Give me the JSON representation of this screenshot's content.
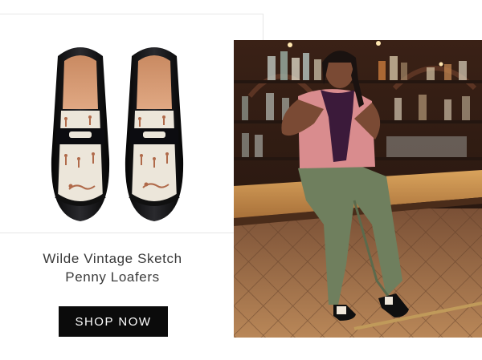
{
  "product": {
    "title_line1": "Wilde Vintage Sketch",
    "title_line2": "Penny Loafers"
  },
  "cta": {
    "label": "SHOP NOW"
  },
  "colors": {
    "button_bg": "#0b0b0b",
    "button_text": "#ffffff",
    "title_text": "#3a3a3a"
  }
}
